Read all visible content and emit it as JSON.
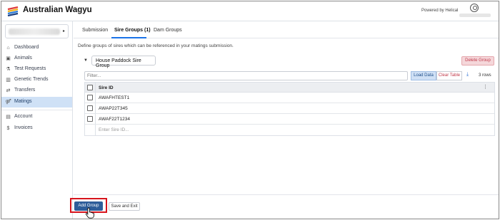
{
  "header": {
    "app_title": "Australian Wagyu",
    "powered_by": "Powered by Helical"
  },
  "sidebar": {
    "items": [
      {
        "label": "Dashboard",
        "icon": "home-icon"
      },
      {
        "label": "Animals",
        "icon": "animals-icon"
      },
      {
        "label": "Test Requests",
        "icon": "flask-icon"
      },
      {
        "label": "Genetic Trends",
        "icon": "chart-icon"
      },
      {
        "label": "Transfers",
        "icon": "transfer-icon"
      },
      {
        "label": "Matings",
        "icon": "matings-icon",
        "active": true
      },
      {
        "label": "Account",
        "icon": "account-icon"
      },
      {
        "label": "Invoices",
        "icon": "dollar-icon"
      }
    ]
  },
  "tabs": [
    "Submission",
    "Sire Groups (1)",
    "Dam Groups"
  ],
  "description": "Define groups of sires which can be referenced in your matings submission.",
  "group": {
    "name": "House Paddock Sire Group",
    "delete_label": "Delete Group"
  },
  "toolbar": {
    "filter_placeholder": "Filter...",
    "load_label": "Load Data",
    "clear_label": "Clear Table",
    "row_count": "3 rows"
  },
  "grid": {
    "column": "Sire ID",
    "rows": [
      "AWAFHTEST1",
      "AWAP22T345",
      "AWAF22T1234"
    ],
    "new_row_placeholder": "Enter Sire ID..."
  },
  "footer": {
    "add_group_label": "Add Group",
    "save_exit_label": "Save and Exit"
  },
  "colors": {
    "primary": "#2d5d99",
    "tab_accent": "#1a73e8",
    "active_nav": "#cfe1f6",
    "danger": "#c0394a",
    "highlight": "#d7141c"
  }
}
